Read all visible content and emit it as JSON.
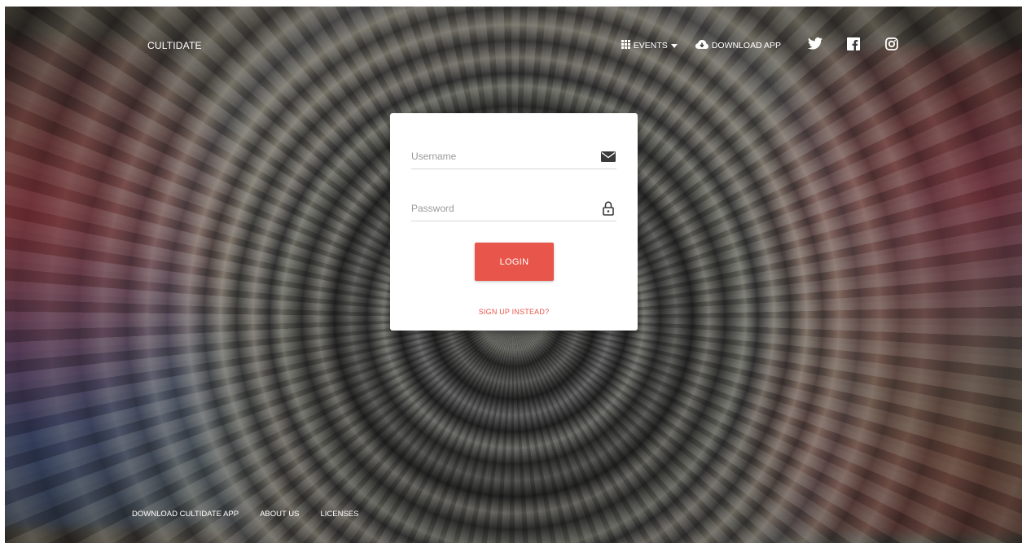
{
  "brand": "CULTIDATE",
  "nav": {
    "events_label": "EVENTS",
    "download_label": "DOWNLOAD APP",
    "icons": [
      "grid-icon",
      "caret-down-icon",
      "cloud-download-icon",
      "twitter-icon",
      "facebook-icon",
      "instagram-icon"
    ]
  },
  "login": {
    "username_placeholder": "Username",
    "password_placeholder": "Password",
    "username_icon": "envelope-icon",
    "password_icon": "lock-icon",
    "login_label": "LOGIN",
    "signup_label": "SIGN UP INSTEAD?"
  },
  "footer": {
    "links": [
      "DOWNLOAD CULTIDATE APP",
      "ABOUT US",
      "LICENSES"
    ]
  },
  "colors": {
    "accent": "#e8554a",
    "card": "#ffffff",
    "nav_text": "#ffffff"
  }
}
